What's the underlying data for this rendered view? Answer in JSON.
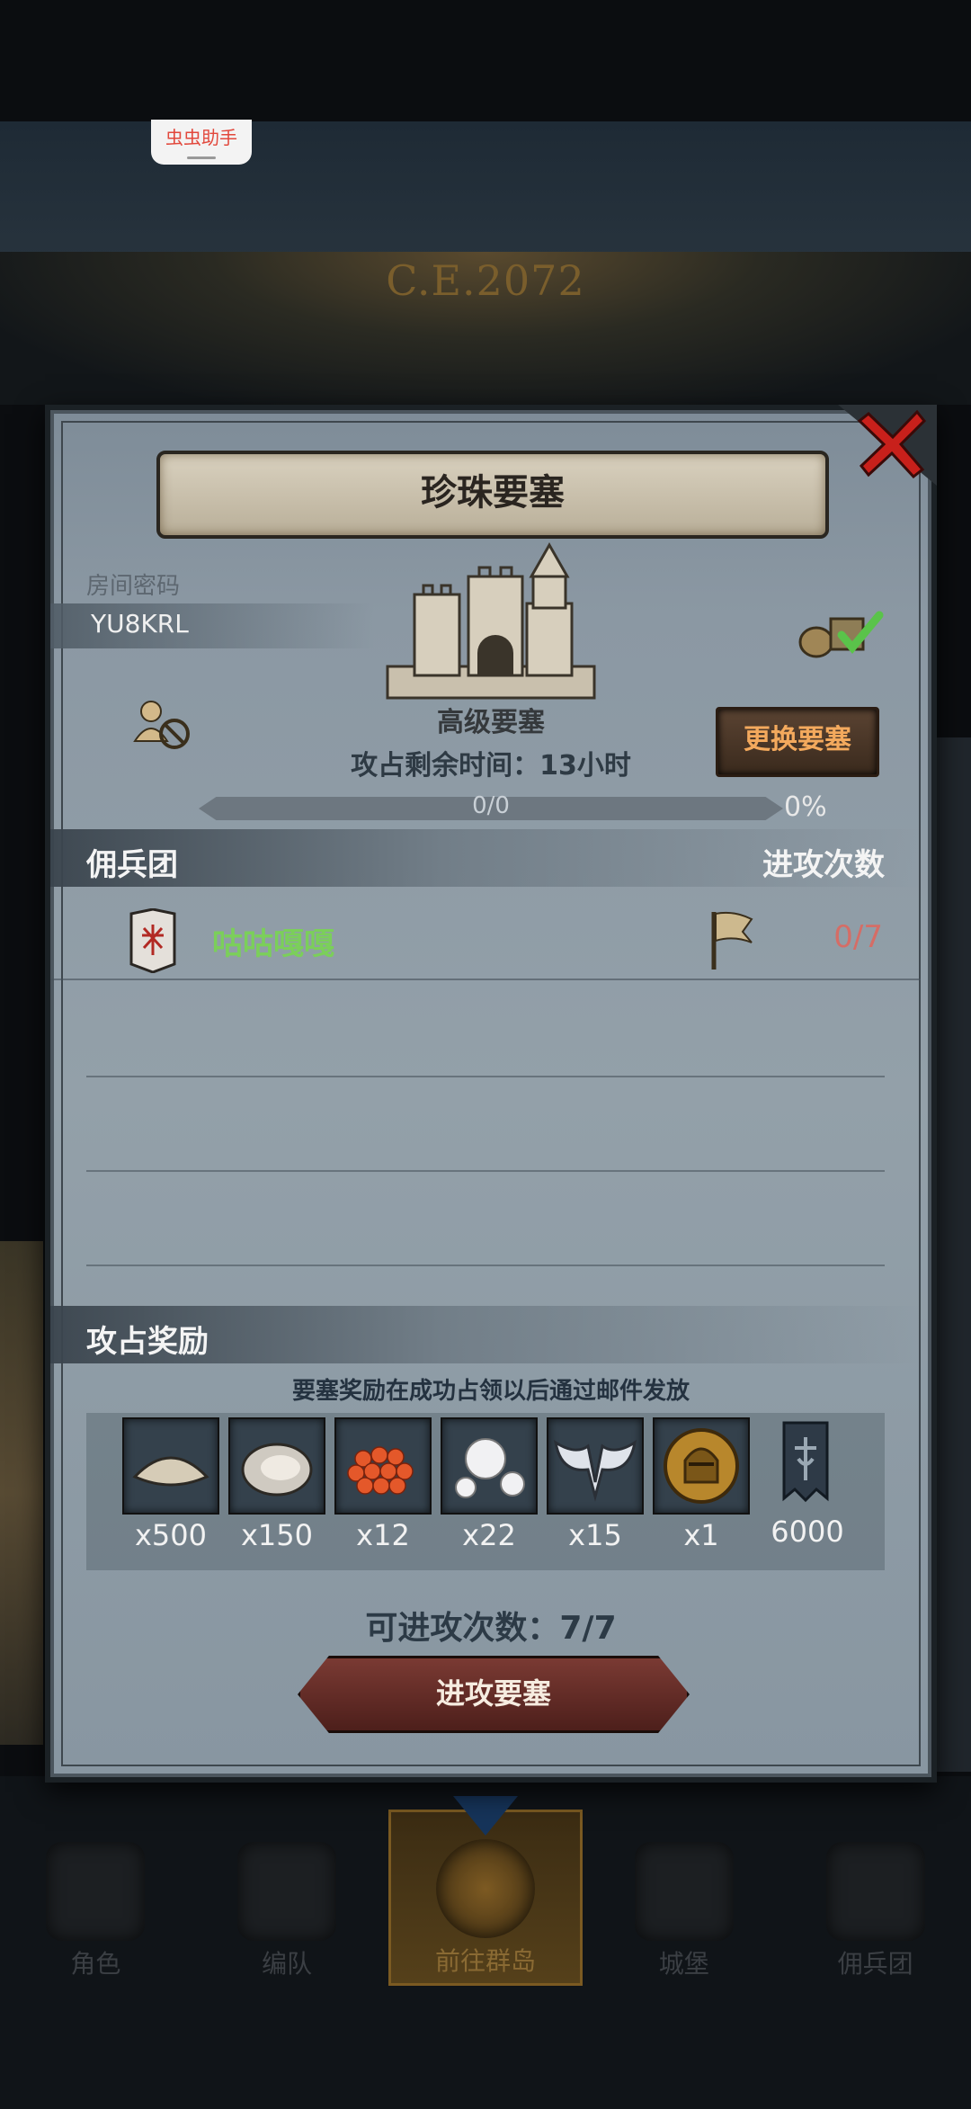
{
  "status_overlay": {
    "assistant_label": "虫虫助手"
  },
  "background": {
    "era_text": "C.E.2072"
  },
  "dialog": {
    "title": "珍珠要塞",
    "room_password_label": "房间密码",
    "room_code": "YU8KRL",
    "fortress_level": "高级要塞",
    "change_button": "更换要塞",
    "time_left_label": "攻占剩余时间：",
    "time_left_value": "13小时",
    "progress": {
      "text": "0/0",
      "percent_text": "0%",
      "fraction": 0
    },
    "mercenary_header": "佣兵团",
    "attack_times_header": "进攻次数",
    "guilds": [
      {
        "name": "咕咕嘎嘎",
        "attacks": "0/7"
      }
    ],
    "reward_header": "攻占奖励",
    "reward_note": "要塞奖励在成功占领以后通过邮件发放",
    "rewards": [
      {
        "icon": "shell-icon",
        "qty": "x500"
      },
      {
        "icon": "oyster-icon",
        "qty": "x150"
      },
      {
        "icon": "roe-icon",
        "qty": "x12"
      },
      {
        "icon": "pearl-icon",
        "qty": "x22"
      },
      {
        "icon": "wing-emblem-icon",
        "qty": "x15"
      },
      {
        "icon": "knight-medal-icon",
        "qty": "x1"
      },
      {
        "icon": "guild-banner-icon",
        "qty": "6000"
      }
    ],
    "attacks_available_label": "可进攻次数：",
    "attacks_available_value": "7/7",
    "attack_button": "进攻要塞"
  },
  "bottom_nav": [
    {
      "label": "角色",
      "active": false
    },
    {
      "label": "编队",
      "active": false
    },
    {
      "label": "前往群岛",
      "active": true
    },
    {
      "label": "城堡",
      "active": false
    },
    {
      "label": "佣兵团",
      "active": false
    }
  ],
  "colors": {
    "guild_name": "#7bcf5a",
    "attack_count": "#d56d66",
    "change_button_text": "#f3a95d",
    "close_x": "#c8201b"
  }
}
